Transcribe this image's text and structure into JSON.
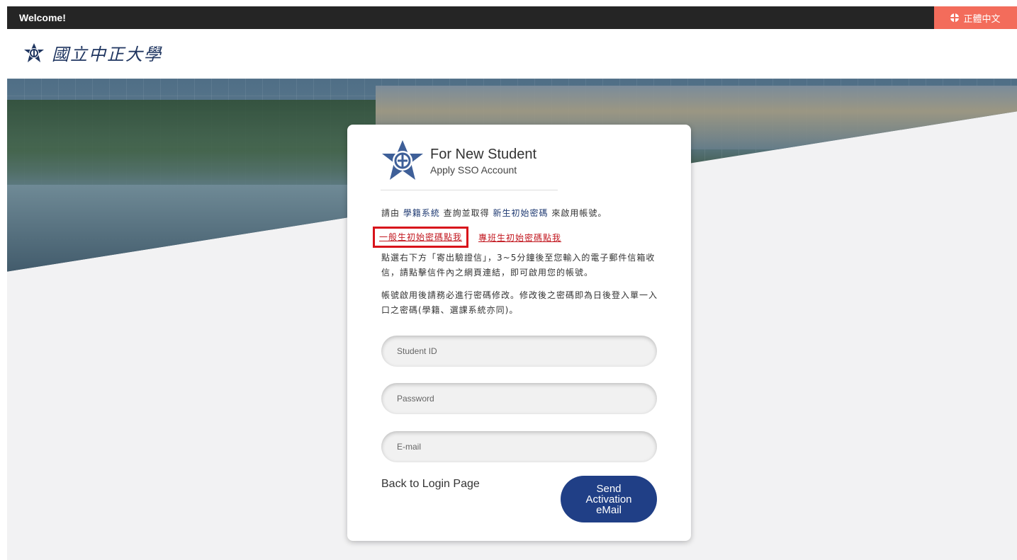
{
  "topbar": {
    "welcome": "Welcome!",
    "language": "正體中文"
  },
  "header": {
    "university_name": "國立中正大學"
  },
  "card": {
    "title": "For New Student",
    "subtitle": "Apply SSO Account",
    "info1_prefix": "請由 ",
    "info1_link1": "學籍系統",
    "info1_mid": " 查詢並取得 ",
    "info1_link2": "新生初始密碼",
    "info1_suffix": " 來啟用帳號。",
    "link_general": "一般生初始密碼點我",
    "link_special": "專班生初始密碼點我",
    "info2": "點選右下方「寄出驗證信」，3~5分鐘後至您輸入的電子郵件信箱收信，請點擊信件內之網頁連結，即可啟用您的帳號。",
    "info3": "帳號啟用後請務必進行密碼修改。修改後之密碼即為日後登入單一入口之密碼(學籍、選課系統亦同)。",
    "student_id_placeholder": "Student ID",
    "password_placeholder": "Password",
    "email_placeholder": "E-mail",
    "back_link": "Back to Login Page",
    "send_button": "Send\nActivation\neMail"
  },
  "colors": {
    "topbar": "#252525",
    "language_button": "#f36c5b",
    "primary": "#203f86",
    "link_red": "#c2171f"
  },
  "icons": {
    "language": "globe-icon",
    "logo": "university-emblem-icon"
  }
}
